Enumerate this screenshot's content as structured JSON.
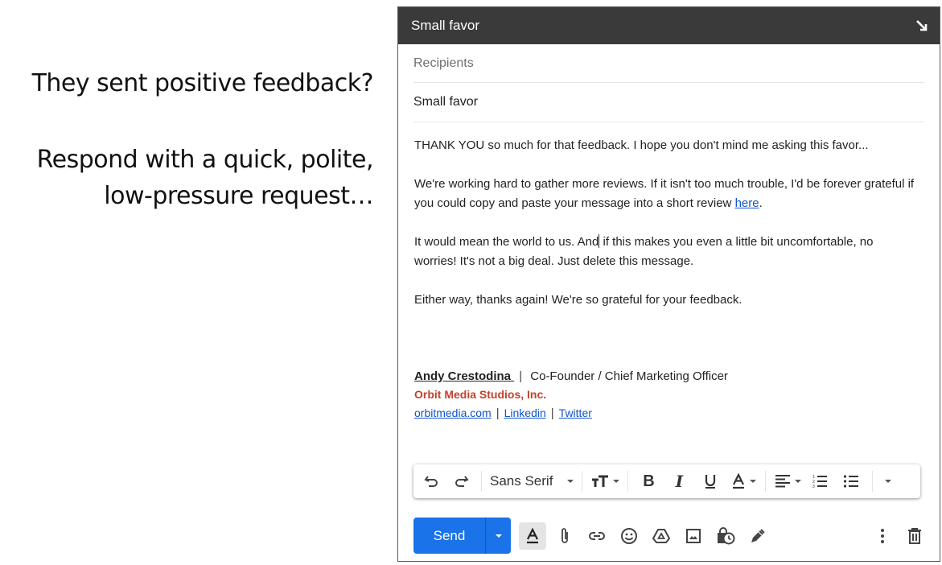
{
  "slide": {
    "caption_1": "They sent positive feedback?",
    "caption_2_line1": "Respond with a quick, polite,",
    "caption_2_line2": "low-pressure request…"
  },
  "compose": {
    "window_title": "Small favor",
    "minimize_icon": "arrow-down-right-icon",
    "recipients_placeholder": "Recipients",
    "subject_value": "Small favor",
    "body": {
      "p1": "THANK YOU so much for that feedback. I hope you don't mind me asking this favor...",
      "p2_before_link": "We're working hard to gather more reviews. If it isn't too much trouble, I'd be forever grateful if you could copy and paste your message into a short review ",
      "p2_link": "here",
      "p2_after_link": ".",
      "p3_before_cursor": "It would mean the world to us. And",
      "p3_after_cursor": " if this makes you even a little bit uncomfortable, no worries! It's not a big deal. Just delete this message.",
      "p4": "Either way, thanks again! We're so grateful for your feedback."
    },
    "signature": {
      "name": "Andy Crestodina ",
      "separator": "|",
      "title": "Co-Founder / Chief Marketing Officer",
      "company": "Orbit Media Studios, Inc.",
      "links": [
        "orbitmedia.com",
        "Linkedin",
        "Twitter"
      ],
      "company_color": "#c0432b"
    },
    "formatting_toolbar": {
      "font_family": "Sans Serif",
      "items": [
        "undo",
        "redo",
        "font",
        "text-size",
        "bold",
        "italic",
        "underline",
        "text-color",
        "align",
        "numbered-list",
        "bulleted-list",
        "more-formatting"
      ]
    },
    "bottom_bar": {
      "send_label": "Send",
      "send_color": "#1a73e8",
      "icons": [
        "formatting-options",
        "attach-files",
        "insert-link",
        "insert-emoji",
        "google-drive",
        "insert-photo",
        "confidential-mode",
        "insert-signature",
        "more-options",
        "discard-draft"
      ]
    }
  }
}
